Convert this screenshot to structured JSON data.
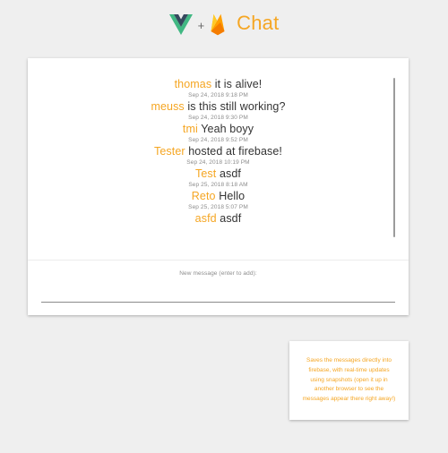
{
  "header": {
    "vue_logo": "vue-logo",
    "plus_sign": "+",
    "firebase_logo": "firebase-logo",
    "title": "Chat"
  },
  "colors": {
    "accent": "#f5a623",
    "background": "#efefef",
    "vue_green": "#41b883",
    "vue_dark": "#35495e"
  },
  "chat": {
    "messages": [
      {
        "user": "thomas",
        "text": "it is alive!",
        "time": "Sep 24, 2018 9:18 PM"
      },
      {
        "user": "meuss",
        "text": "is this still working?",
        "time": "Sep 24, 2018 9:30 PM"
      },
      {
        "user": "tmi",
        "text": "Yeah boyy",
        "time": "Sep 24, 2018 9:52 PM"
      },
      {
        "user": "Tester",
        "text": "hosted at firebase!",
        "time": "Sep 24, 2018 10:19 PM"
      },
      {
        "user": "Test",
        "text": "asdf",
        "time": "Sep 25, 2018 8:18 AM"
      },
      {
        "user": "Reto",
        "text": "Hello",
        "time": "Sep 25, 2018 5:07 PM"
      },
      {
        "user": "asfd",
        "text": "asdf",
        "time": ""
      }
    ],
    "new_message_label": "New message (enter to add):",
    "new_message_value": ""
  },
  "info": {
    "text": "Saves the messages directly into firebase, with real-time updates using snapshots (open it up in another browser to see the messages appear there right away!)"
  }
}
